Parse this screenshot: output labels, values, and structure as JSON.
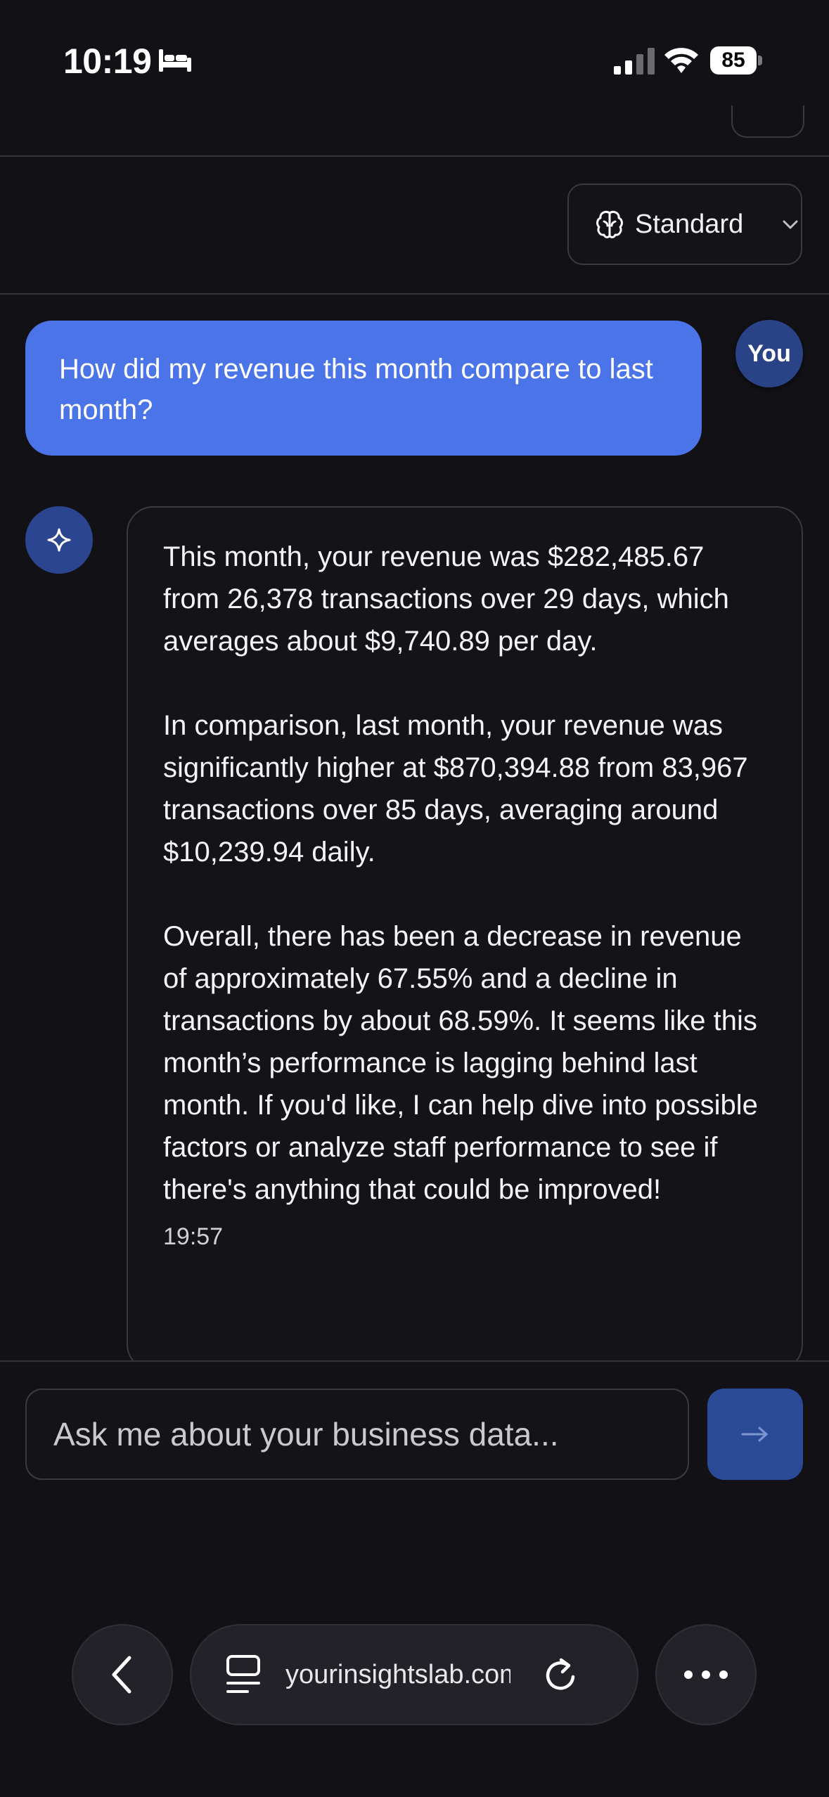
{
  "status_bar": {
    "time": "10:19",
    "battery": "85"
  },
  "model_selector": {
    "label": "Standard"
  },
  "messages": {
    "user": {
      "text": "How did my revenue this month compare to last month?",
      "avatar_label": "You"
    },
    "assistant": {
      "paragraphs": [
        "This month, your revenue was $282,485.67 from 26,378 transactions over 29 days, which averages about $9,740.89 per day.",
        "In comparison, last month, your revenue was significantly higher at $870,394.88 from 83,967 transactions over 85 days, averaging around $10,239.94 daily.",
        "Overall, there has been a decrease in revenue of approximately 67.55% and a decline in transactions by about 68.59%. It seems like this month’s performance is lagging behind last month. If you'd like, I can help dive into possible factors or analyze staff performance to see if there's anything that could be improved!"
      ],
      "time": "19:57"
    }
  },
  "composer": {
    "placeholder": "Ask me about your business data...",
    "send_icon": "arrow-right-icon"
  },
  "browser": {
    "url": "yourinsightslab.com"
  },
  "colors": {
    "background": "#111116",
    "user_bubble": "#4a74e8",
    "send_button": "#2a4a98",
    "avatar": "#2c4590"
  }
}
